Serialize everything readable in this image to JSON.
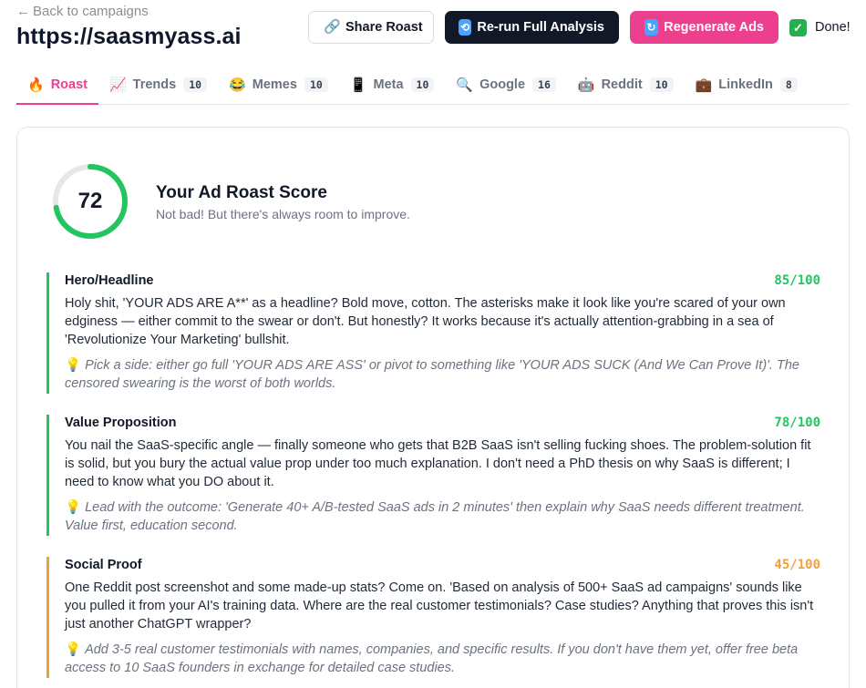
{
  "header": {
    "back_link": "Back to campaigns",
    "back_arrow": "←",
    "site_url": "https://saasmyass.ai"
  },
  "actions": {
    "share": {
      "label": "Share Roast",
      "icon": "link-icon"
    },
    "rerun": {
      "label": "Re-run Full Analysis",
      "icon": "repeat-icon"
    },
    "regenerate": {
      "label": "Regenerate Ads",
      "icon": "refresh-icon"
    },
    "status": {
      "label": "Done!",
      "icon": "check-icon"
    }
  },
  "tabs": [
    {
      "label": "Roast",
      "emoji": "🔥",
      "count": ""
    },
    {
      "label": "Trends",
      "emoji": "📈",
      "count": "10"
    },
    {
      "label": "Memes",
      "emoji": "😂",
      "count": "10"
    },
    {
      "label": "Meta",
      "emoji": "📱",
      "count": "10"
    },
    {
      "label": "Google",
      "emoji": "🔍",
      "count": "16"
    },
    {
      "label": "Reddit",
      "emoji": "🤖",
      "count": "10"
    },
    {
      "label": "LinkedIn",
      "emoji": "💼",
      "count": "8"
    }
  ],
  "score": {
    "value": "72",
    "fraction": 0.72,
    "title": "Your Ad Roast Score",
    "subtitle": "Not bad! But there's always room to improve.",
    "color": "#22c55e"
  },
  "sections": [
    {
      "title": "Hero/Headline",
      "score": "85/100",
      "body": "Holy shit, 'YOUR ADS ARE A**' as a headline? Bold move, cotton. The asterisks make it look like you're scared of your own edginess — either commit to the swear or don't. But honestly? It works because it's actually attention-grabbing in a sea of 'Revolutionize Your Marketing' bullshit.",
      "tip": "Pick a side: either go full 'YOUR ADS ARE ASS' or pivot to something like 'YOUR ADS SUCK (And We Can Prove It)'. The censored swearing is the worst of both worlds.",
      "tip_icon": "💡"
    },
    {
      "title": "Value Proposition",
      "score": "78/100",
      "body": "You nail the SaaS-specific angle — finally someone who gets that B2B SaaS isn't selling fucking shoes. The problem-solution fit is solid, but you bury the actual value prop under too much explanation. I don't need a PhD thesis on why SaaS is different; I need to know what you DO about it.",
      "tip": "Lead with the outcome: 'Generate 40+ A/B-tested SaaS ads in 2 minutes' then explain why SaaS needs different treatment. Value first, education second.",
      "tip_icon": "💡"
    },
    {
      "title": "Social Proof",
      "score": "45/100",
      "body": "One Reddit post screenshot and some made-up stats? Come on. 'Based on analysis of 500+ SaaS ad campaigns' sounds like you pulled it from your AI's training data. Where are the real customer testimonials? Case studies? Anything that proves this isn't just another ChatGPT wrapper?",
      "tip": "Add 3-5 real customer testimonials with names, companies, and specific results. If you don't have them yet, offer free beta access to 10 SaaS founders in exchange for detailed case studies.",
      "tip_icon": "💡"
    }
  ]
}
